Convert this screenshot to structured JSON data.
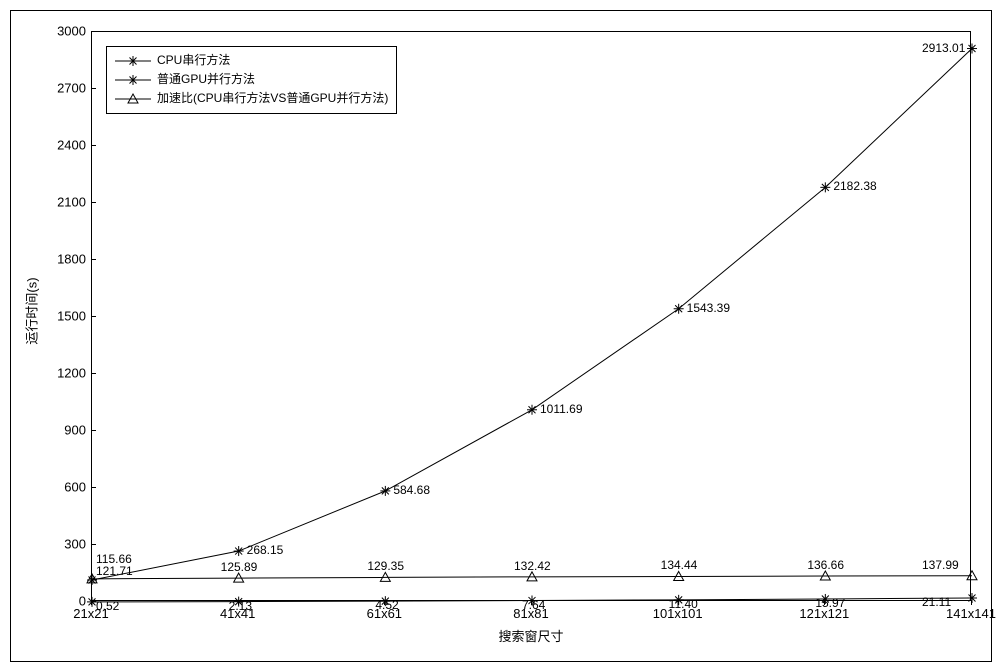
{
  "chart_data": {
    "type": "line",
    "xlabel": "搜索窗尺寸",
    "ylabel": "运行时间(s)",
    "categories": [
      "21x21",
      "41x41",
      "61x61",
      "81x81",
      "101x101",
      "121x121",
      "141x141"
    ],
    "ylim": [
      0,
      3000
    ],
    "yticks": [
      0,
      300,
      600,
      900,
      1200,
      1500,
      1800,
      2100,
      2400,
      2700,
      3000
    ],
    "series": [
      {
        "name": "CPU串行方法",
        "marker": "star",
        "values": [
          115.66,
          268.15,
          584.68,
          1011.69,
          1543.39,
          2182.38,
          2913.01
        ],
        "data_labels": [
          "115.66",
          "268.15",
          "584.68",
          "1011.69",
          "1543.39",
          "2182.38",
          "2913.01"
        ]
      },
      {
        "name": "普通GPU并行方法",
        "marker": "star",
        "values": [
          0.52,
          2.13,
          4.52,
          7.64,
          11.4,
          15.97,
          21.11
        ],
        "data_labels": [
          "0.52",
          "2.13",
          "4.52",
          "7.64",
          "11.40",
          "15.97",
          "21.11"
        ]
      },
      {
        "name": "加速比(CPU串行方法VS普通GPU并行方法)",
        "marker": "triangle",
        "values": [
          121.71,
          125.89,
          129.35,
          132.42,
          134.44,
          136.66,
          137.99
        ],
        "data_labels": [
          "121.71",
          "125.89",
          "129.35",
          "132.42",
          "134.44",
          "136.66",
          "137.99"
        ]
      }
    ],
    "legend": {
      "position": "upper-left",
      "entries": [
        "CPU串行方法",
        "普通GPU并行方法",
        "加速比(CPU串行方法VS普通GPU并行方法)"
      ]
    }
  }
}
